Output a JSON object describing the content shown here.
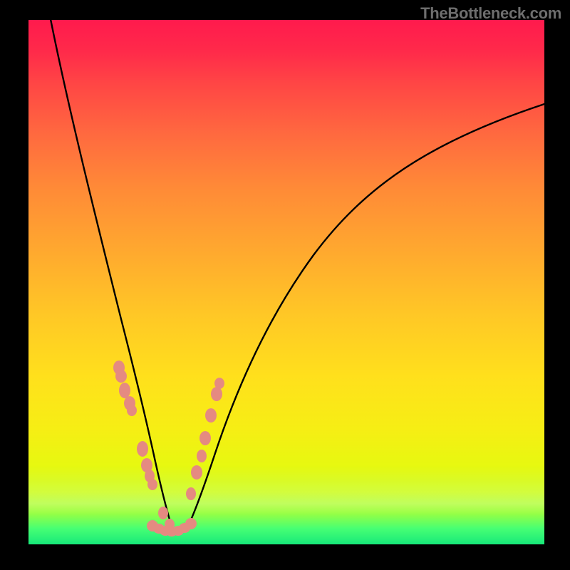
{
  "watermark": "TheBottleneck.com",
  "colors": {
    "gradient_top": "#ff1a4d",
    "gradient_mid": "#ffe01c",
    "gradient_bottom": "#17e87a",
    "curve": "#000000",
    "dot": "#e58a81",
    "frame_bg": "#000000"
  },
  "chart_data": {
    "type": "line",
    "title": "",
    "xlabel": "",
    "ylabel": "",
    "xlim": [
      0,
      100
    ],
    "ylim": [
      0,
      100
    ],
    "legend": false,
    "grid": false,
    "watermark": "TheBottleneck.com",
    "series": [
      {
        "name": "left-curve",
        "x": [
          4,
          6,
          8,
          10,
          12,
          14,
          16,
          18,
          20,
          22,
          23,
          24,
          25,
          26,
          27
        ],
        "y": [
          100,
          86,
          73,
          63,
          54,
          46,
          39,
          32,
          25,
          17,
          13,
          9,
          6,
          4,
          3
        ]
      },
      {
        "name": "right-curve",
        "x": [
          30,
          32,
          34,
          36,
          38,
          42,
          46,
          50,
          55,
          60,
          66,
          72,
          80,
          88,
          96,
          100
        ],
        "y": [
          3,
          7,
          13,
          19,
          25,
          35,
          43,
          50,
          57,
          62,
          67,
          71,
          75,
          79,
          82,
          84
        ]
      },
      {
        "name": "left-dots",
        "type": "scatter",
        "x": [
          17.5,
          17.8,
          18.6,
          19.4,
          19.9,
          22.0,
          22.8,
          23.4,
          24.0,
          26.0,
          27.5
        ],
        "y": [
          33.5,
          32.0,
          29.5,
          27.0,
          25.5,
          18.0,
          15.0,
          13.0,
          11.5,
          6.0,
          4.0
        ]
      },
      {
        "name": "right-dots",
        "type": "scatter",
        "x": [
          31.5,
          32.5,
          33.4,
          34.2,
          35.2,
          36.5,
          37.0
        ],
        "y": [
          9.5,
          13.5,
          16.5,
          20.0,
          24.5,
          28.5,
          30.5
        ]
      },
      {
        "name": "bottom-dots",
        "type": "scatter",
        "x": [
          24.0,
          25.2,
          26.4,
          27.7,
          29.0,
          30.3,
          31.4
        ],
        "y": [
          3.3,
          2.8,
          2.5,
          2.5,
          2.7,
          3.2,
          3.8
        ]
      }
    ]
  }
}
